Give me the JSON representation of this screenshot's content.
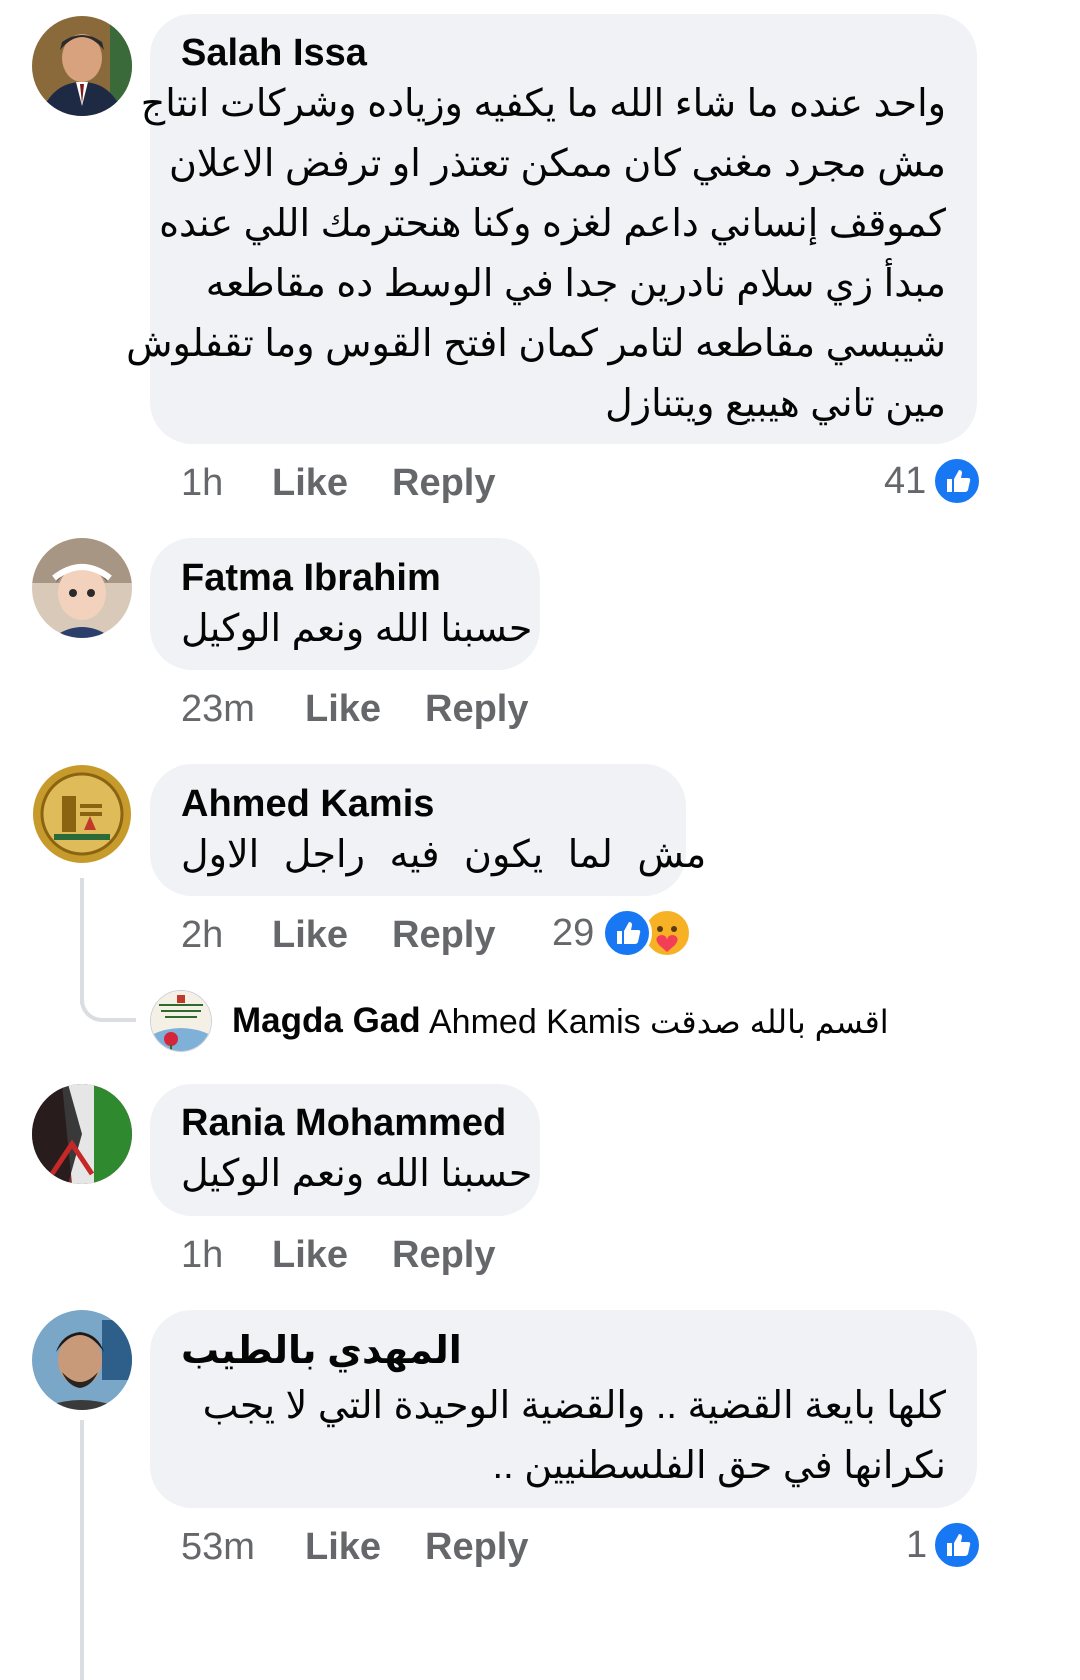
{
  "comments": [
    {
      "name": "Salah Issa",
      "lines": [
        "واحد عنده ما شاء الله ما يكفيه وزياده وشركات انتاج",
        "مش مجرد مغني كان ممكن تعتذر او ترفض الاعلان",
        "كموقف إنساني داعم لغزه وكنا هنحترمك اللي عنده",
        "مبدأ زي سلام نادرين جدا في الوسط ده مقاطعه",
        "شيبسي مقاطعه لتامر كمان افتح القوس وما تقفلوش",
        "مين تاني هيبيع ويتنازل"
      ],
      "time": "1h",
      "like": "Like",
      "reply": "Reply",
      "reactions": "41"
    },
    {
      "name": "Fatma Ibrahim",
      "lines": [
        "حسبنا الله ونعم الوكيل"
      ],
      "time": "23m",
      "like": "Like",
      "reply": "Reply"
    },
    {
      "name": "Ahmed Kamis",
      "lines": [
        "مش لما يكون فيه راجل الاول"
      ],
      "time": "2h",
      "like": "Like",
      "reply": "Reply",
      "reactions": "29"
    },
    {
      "name": "Rania Mohammed",
      "lines": [
        "حسبنا الله ونعم الوكيل"
      ],
      "time": "1h",
      "like": "Like",
      "reply": "Reply"
    },
    {
      "name": "المهدي بالطيب",
      "lines": [
        "كلها بايعة القضية .. والقضية الوحيدة التي لا يجب",
        "نكرانها في حق الفلسطنيين .."
      ],
      "time": "53m",
      "like": "Like",
      "reply": "Reply",
      "reactions": "1"
    }
  ],
  "reply_preview": {
    "name": "Magda Gad",
    "tag": "Ahmed Kamis",
    "text": "اقسم بالله صدقت"
  },
  "colors": {
    "bubble": "#f0f2f5",
    "meta_text": "#65676b",
    "like_blue": "#1877f2"
  },
  "icons": [
    "like-reaction-icon",
    "care-reaction-icon"
  ]
}
